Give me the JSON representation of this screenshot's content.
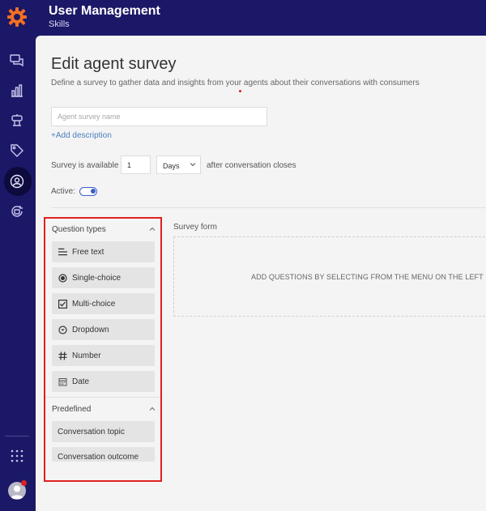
{
  "header": {
    "title": "User Management",
    "subtitle": "Skills"
  },
  "sidebar": {
    "items": [
      {
        "icon": "chat-icon"
      },
      {
        "icon": "bar-chart-icon"
      },
      {
        "icon": "robot-icon"
      },
      {
        "icon": "tag-icon"
      },
      {
        "icon": "users-icon",
        "active": true
      },
      {
        "icon": "bot-refresh-icon"
      }
    ],
    "apps_icon": "apps-grid-icon",
    "accent": "#f37021"
  },
  "page": {
    "title": "Edit agent survey",
    "description": "Define a survey to gather data and insights from your agents about their conversations with consumers"
  },
  "form": {
    "name_placeholder": "Agent survey name",
    "add_description": "+Add description",
    "available_label": "Survey is available",
    "available_value": "1",
    "unit_value": "Days",
    "after_label": "after conversation closes",
    "active_label": "Active:",
    "active": true
  },
  "question_types": {
    "title": "Question types",
    "items": [
      {
        "label": "Free text",
        "icon": "text-lines-icon"
      },
      {
        "label": "Single-choice",
        "icon": "radio-icon"
      },
      {
        "label": "Multi-choice",
        "icon": "checkbox-icon"
      },
      {
        "label": "Dropdown",
        "icon": "dropdown-icon"
      },
      {
        "label": "Number",
        "icon": "hash-icon"
      },
      {
        "label": "Date",
        "icon": "calendar-icon"
      }
    ]
  },
  "predefined": {
    "title": "Predefined",
    "items": [
      {
        "label": "Conversation topic"
      },
      {
        "label": "Conversation outcome"
      }
    ]
  },
  "survey_form": {
    "title": "Survey form",
    "empty_text": "ADD QUESTIONS BY SELECTING FROM THE MENU ON THE LEFT"
  }
}
